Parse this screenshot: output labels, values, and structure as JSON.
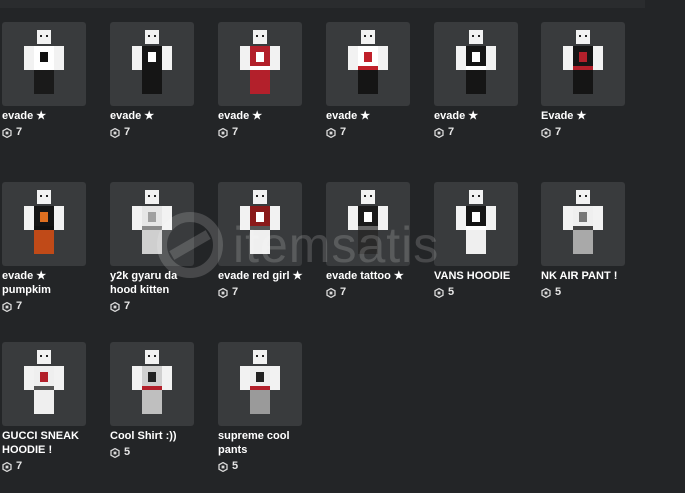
{
  "watermark": "itemsatis",
  "items": [
    {
      "name": "evade ★",
      "price": "7",
      "variant": "black-skirt"
    },
    {
      "name": "evade ★",
      "price": "7",
      "variant": "black-dress"
    },
    {
      "name": "evade ★",
      "price": "7",
      "variant": "red-dress"
    },
    {
      "name": "evade ★",
      "price": "7",
      "variant": "black-red-dress"
    },
    {
      "name": "evade ★",
      "price": "7",
      "variant": "black-white-dress"
    },
    {
      "name": "Evade ★",
      "price": "7",
      "variant": "black-red-trim"
    },
    {
      "name": "evade ★ pumpkim",
      "price": "7",
      "variant": "pumpkin"
    },
    {
      "name": "y2k gyaru da hood kitten",
      "price": "7",
      "variant": "white-top"
    },
    {
      "name": "evade red girl ★",
      "price": "7",
      "variant": "red-top"
    },
    {
      "name": "evade tattoo ★",
      "price": "7",
      "variant": "tattoo"
    },
    {
      "name": "VANS HOODIE",
      "price": "5",
      "variant": "vans"
    },
    {
      "name": "NK AIR PANT !",
      "price": "5",
      "variant": "pants"
    },
    {
      "name": "GUCCI SNEAK HOODIE !",
      "price": "7",
      "variant": "gucci"
    },
    {
      "name": "Cool Shirt :))",
      "price": "5",
      "variant": "cool-shirt"
    },
    {
      "name": "supreme cool pants",
      "price": "5",
      "variant": "supreme"
    }
  ]
}
